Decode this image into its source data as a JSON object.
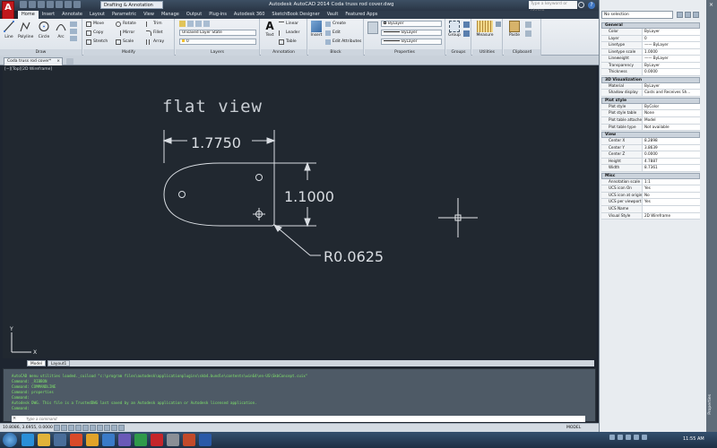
{
  "app": {
    "logo_letter": "A",
    "workspace": "Drafting & Annotation",
    "title": "Autodesk AutoCAD 2014   Coda truss rod cover.dwg",
    "search_placeholder": "Type a keyword or phrase",
    "help": "?"
  },
  "ribbon_tabs": [
    "Home",
    "Insert",
    "Annotate",
    "Layout",
    "Parametric",
    "View",
    "Manage",
    "Output",
    "Plug-ins",
    "Autodesk 360",
    "SketchBook Designer",
    "Vault",
    "Featured Apps"
  ],
  "ribbon": {
    "draw": {
      "title": "Draw",
      "line": "Line",
      "polyline": "Polyline",
      "circle": "Circle",
      "arc": "Arc"
    },
    "modify": {
      "title": "Modify",
      "move": "Move",
      "rotate": "Rotate",
      "trim": "Trim",
      "copy": "Copy",
      "mirror": "Mirror",
      "fillet": "Fillet",
      "stretch": "Stretch",
      "scale": "Scale",
      "array": "Array"
    },
    "layers": {
      "title": "Layers",
      "layer_state": "Unsaved Layer State",
      "current_layer": "0"
    },
    "annotation": {
      "title": "Annotation",
      "text": "Text",
      "linear": "Linear",
      "leader": "Leader",
      "table": "Table"
    },
    "block": {
      "title": "Block",
      "insert": "Insert",
      "create": "Create",
      "edit": "Edit",
      "edit_attributes": "Edit Attributes"
    },
    "properties": {
      "title": "Properties",
      "color": "ByLayer",
      "linetype": "ByLayer",
      "lineweight": "ByLayer"
    },
    "groups": {
      "title": "Groups",
      "group": "Group"
    },
    "utilities": {
      "title": "Utilities",
      "measure": "Measure"
    },
    "clipboard": {
      "title": "Clipboard",
      "paste": "Paste"
    }
  },
  "document_tab": "Coda truss rod cover*",
  "viewport_label": "[−][Top][2D Wireframe]",
  "layout_tabs": [
    "Model",
    "Layout1"
  ],
  "drawing": {
    "title": "flat view",
    "dim_width": "1.7750",
    "dim_height": "1.1000",
    "dim_radius": "R0.0625"
  },
  "command_window": {
    "history": [
      "AutoCAD menu utilities loaded._cuiload \"c:\\program files\\autodesk\\applicationplugins\\skb4.bundle\\contents\\win64\\en-US\\SkbConcept.cuix\"",
      "Command: _RIBBON",
      "Command: COMMANDLINE",
      "Command: properties",
      "Command:",
      "Autodesk DWG.  This file is a TrustedDWG last saved by an Autodesk application or Autodesk licensed application.",
      "Command:"
    ],
    "placeholder": "Type a command"
  },
  "status": {
    "coords": "10.8086, 3.6955, 0.0000",
    "model": "MODEL"
  },
  "properties_palette": {
    "selection": "No selection",
    "rail_label": "Properties",
    "sections": [
      {
        "title": "General",
        "rows": [
          [
            "Color",
            "ByLayer"
          ],
          [
            "Layer",
            "0"
          ],
          [
            "Linetype",
            "—— ByLayer"
          ],
          [
            "Linetype scale",
            "1.0000"
          ],
          [
            "Lineweight",
            "—— ByLayer"
          ],
          [
            "Transparency",
            "ByLayer"
          ],
          [
            "Thickness",
            "0.0000"
          ]
        ]
      },
      {
        "title": "3D Visualization",
        "rows": [
          [
            "Material",
            "ByLayer"
          ],
          [
            "Shadow display",
            "Casts and Receives Sh..."
          ]
        ]
      },
      {
        "title": "Plot style",
        "rows": [
          [
            "Plot style",
            "ByColor"
          ],
          [
            "Plot style table",
            "None"
          ],
          [
            "Plot table attache...",
            "Model"
          ],
          [
            "Plot table type",
            "Not available"
          ]
        ]
      },
      {
        "title": "View",
        "rows": [
          [
            "Center X",
            "8.2898"
          ],
          [
            "Center Y",
            "3.8639"
          ],
          [
            "Center Z",
            "0.0000"
          ],
          [
            "Height",
            "4.7887"
          ],
          [
            "Width",
            "8.7361"
          ]
        ]
      },
      {
        "title": "Misc",
        "rows": [
          [
            "Annotation scale",
            "1:1"
          ],
          [
            "UCS icon On",
            "Yes"
          ],
          [
            "UCS icon at origin",
            "No"
          ],
          [
            "UCS per viewport",
            "Yes"
          ],
          [
            "UCS Name",
            ""
          ],
          [
            "Visual Style",
            "2D Wireframe"
          ]
        ]
      }
    ]
  },
  "taskbar": {
    "time": "11:55 AM"
  }
}
